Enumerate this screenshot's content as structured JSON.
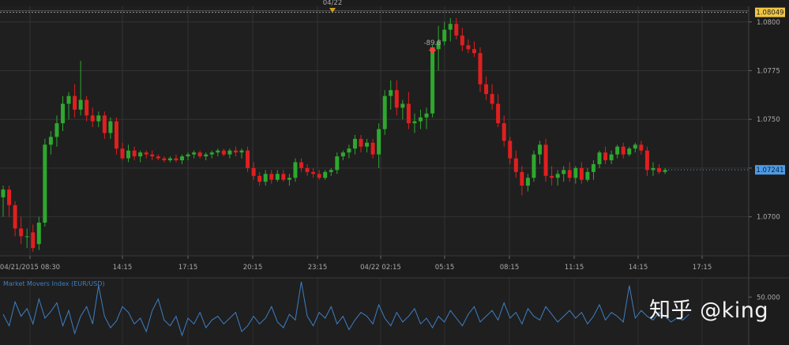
{
  "chart_data": [
    {
      "type": "candlestick",
      "title": "",
      "date_marker": "04/22",
      "x_tick_labels": [
        "04/21/2015 08:30",
        "14:15",
        "17:15",
        "20:15",
        "23:15",
        "04/22 02:15",
        "05:15",
        "08:15",
        "11:15",
        "14:15",
        "17:15"
      ],
      "y_ticks": [
        1.08,
        1.0775,
        1.075,
        1.0725,
        1.07
      ],
      "y_tick_labels": [
        "1.0800",
        "1.0775",
        "1.0750",
        "1.0725",
        "1.0700"
      ],
      "ylim": [
        1.068,
        1.0808
      ],
      "top_line": {
        "value": 1.08049,
        "label": "1.08049",
        "color": "#f2c744"
      },
      "last_price": {
        "value": 1.07241,
        "label": "1.07241",
        "color": "#4d9be6"
      },
      "annotation": {
        "text": "-89.8",
        "x_index": 72
      },
      "up_color": "#2ea82e",
      "down_color": "#e01f1f",
      "candles": [
        [
          1.071,
          1.0716,
          1.07,
          1.0714
        ],
        [
          1.0714,
          1.0716,
          1.07,
          1.0706
        ],
        [
          1.0706,
          1.0708,
          1.069,
          1.0694
        ],
        [
          1.0694,
          1.07,
          1.0686,
          1.069
        ],
        [
          1.069,
          1.0694,
          1.0684,
          1.069
        ],
        [
          1.0692,
          1.0696,
          1.0682,
          1.0684
        ],
        [
          1.0686,
          1.07,
          1.0683,
          1.0697
        ],
        [
          1.0697,
          1.074,
          1.0695,
          1.0737
        ],
        [
          1.0737,
          1.0744,
          1.0732,
          1.0741
        ],
        [
          1.0741,
          1.0752,
          1.0736,
          1.0748
        ],
        [
          1.0748,
          1.0762,
          1.0744,
          1.0758
        ],
        [
          1.0758,
          1.0764,
          1.075,
          1.0762
        ],
        [
          1.0762,
          1.0768,
          1.0751,
          1.0755
        ],
        [
          1.0755,
          1.078,
          1.0752,
          1.076
        ],
        [
          1.076,
          1.0762,
          1.0749,
          1.0752
        ],
        [
          1.0752,
          1.0756,
          1.0746,
          1.0749
        ],
        [
          1.0749,
          1.0754,
          1.0746,
          1.0752
        ],
        [
          1.0752,
          1.0754,
          1.074,
          1.0743
        ],
        [
          1.0743,
          1.0751,
          1.074,
          1.0749
        ],
        [
          1.0749,
          1.0751,
          1.0732,
          1.0735
        ],
        [
          1.0735,
          1.0738,
          1.0729,
          1.073
        ],
        [
          1.073,
          1.0737,
          1.0728,
          1.0734
        ],
        [
          1.0734,
          1.0736,
          1.0729,
          1.0731
        ],
        [
          1.0731,
          1.0734,
          1.0728,
          1.0733
        ],
        [
          1.0733,
          1.0734,
          1.073,
          1.0732
        ],
        [
          1.0732,
          1.0734,
          1.0729,
          1.0731
        ],
        [
          1.0731,
          1.0732,
          1.0729,
          1.073
        ],
        [
          1.073,
          1.0731,
          1.0728,
          1.0729
        ],
        [
          1.0729,
          1.0731,
          1.0728,
          1.073
        ],
        [
          1.073,
          1.0732,
          1.0728,
          1.0729
        ],
        [
          1.0729,
          1.0732,
          1.0727,
          1.0731
        ],
        [
          1.0731,
          1.0733,
          1.0729,
          1.0732
        ],
        [
          1.0732,
          1.0734,
          1.073,
          1.0733
        ],
        [
          1.0733,
          1.0734,
          1.073,
          1.0731
        ],
        [
          1.0731,
          1.0733,
          1.0729,
          1.0732
        ],
        [
          1.0732,
          1.0734,
          1.073,
          1.0733
        ],
        [
          1.0733,
          1.0735,
          1.0731,
          1.0734
        ],
        [
          1.0734,
          1.0735,
          1.0731,
          1.0732
        ],
        [
          1.0732,
          1.0735,
          1.073,
          1.0734
        ],
        [
          1.0734,
          1.0736,
          1.0731,
          1.0733
        ],
        [
          1.0733,
          1.0735,
          1.073,
          1.0734
        ],
        [
          1.0734,
          1.0736,
          1.0723,
          1.0725
        ],
        [
          1.0725,
          1.0728,
          1.0719,
          1.0721
        ],
        [
          1.0721,
          1.0723,
          1.0716,
          1.0718
        ],
        [
          1.0718,
          1.0724,
          1.0716,
          1.0722
        ],
        [
          1.0722,
          1.0724,
          1.0717,
          1.0719
        ],
        [
          1.0719,
          1.0724,
          1.0718,
          1.0722
        ],
        [
          1.0722,
          1.0724,
          1.0718,
          1.0719
        ],
        [
          1.0719,
          1.0722,
          1.0716,
          1.072
        ],
        [
          1.072,
          1.073,
          1.0718,
          1.0728
        ],
        [
          1.0728,
          1.073,
          1.0723,
          1.0725
        ],
        [
          1.0725,
          1.0727,
          1.0721,
          1.0723
        ],
        [
          1.0723,
          1.0725,
          1.072,
          1.0722
        ],
        [
          1.0722,
          1.0724,
          1.0719,
          1.072
        ],
        [
          1.072,
          1.0724,
          1.0719,
          1.0723
        ],
        [
          1.0723,
          1.0725,
          1.0721,
          1.0724
        ],
        [
          1.0724,
          1.0733,
          1.0722,
          1.0731
        ],
        [
          1.0731,
          1.0734,
          1.0729,
          1.0733
        ],
        [
          1.0733,
          1.0737,
          1.073,
          1.0735
        ],
        [
          1.0735,
          1.0742,
          1.0732,
          1.074
        ],
        [
          1.074,
          1.0742,
          1.0733,
          1.0736
        ],
        [
          1.0736,
          1.074,
          1.0733,
          1.0738
        ],
        [
          1.0738,
          1.074,
          1.073,
          1.0732
        ],
        [
          1.0732,
          1.0748,
          1.0725,
          1.0745
        ],
        [
          1.0745,
          1.0765,
          1.0742,
          1.0762
        ],
        [
          1.0762,
          1.077,
          1.0755,
          1.0765
        ],
        [
          1.0765,
          1.077,
          1.0752,
          1.0756
        ],
        [
          1.0756,
          1.076,
          1.075,
          1.0758
        ],
        [
          1.0758,
          1.0764,
          1.0745,
          1.0748
        ],
        [
          1.0748,
          1.0753,
          1.0743,
          1.0749
        ],
        [
          1.0749,
          1.0755,
          1.0745,
          1.0751
        ],
        [
          1.0751,
          1.0756,
          1.0745,
          1.0753
        ],
        [
          1.0753,
          1.0788,
          1.0751,
          1.0786
        ],
        [
          1.0786,
          1.0798,
          1.0775,
          1.079
        ],
        [
          1.079,
          1.08,
          1.0788,
          1.0796
        ],
        [
          1.0796,
          1.0802,
          1.079,
          1.0799
        ],
        [
          1.0799,
          1.0802,
          1.0791,
          1.0793
        ],
        [
          1.0793,
          1.0797,
          1.0785,
          1.0788
        ],
        [
          1.0788,
          1.0791,
          1.0784,
          1.0786
        ],
        [
          1.0786,
          1.079,
          1.0782,
          1.0784
        ],
        [
          1.0784,
          1.0787,
          1.0764,
          1.0768
        ],
        [
          1.0768,
          1.0772,
          1.076,
          1.0763
        ],
        [
          1.0763,
          1.0768,
          1.0755,
          1.0758
        ],
        [
          1.0758,
          1.0763,
          1.0746,
          1.0748
        ],
        [
          1.0748,
          1.0752,
          1.0736,
          1.0739
        ],
        [
          1.0739,
          1.0741,
          1.0727,
          1.073
        ],
        [
          1.073,
          1.0734,
          1.072,
          1.0723
        ],
        [
          1.0723,
          1.0726,
          1.0711,
          1.0716
        ],
        [
          1.0716,
          1.0722,
          1.0713,
          1.072
        ],
        [
          1.072,
          1.0734,
          1.0718,
          1.0732
        ],
        [
          1.0732,
          1.0739,
          1.0727,
          1.0737
        ],
        [
          1.0737,
          1.074,
          1.0718,
          1.0721
        ],
        [
          1.0721,
          1.0726,
          1.0716,
          1.072
        ],
        [
          1.072,
          1.0724,
          1.0716,
          1.0722
        ],
        [
          1.0722,
          1.0726,
          1.0718,
          1.0724
        ],
        [
          1.0724,
          1.0728,
          1.0718,
          1.072
        ],
        [
          1.072,
          1.0726,
          1.0717,
          1.0725
        ],
        [
          1.0725,
          1.0728,
          1.0717,
          1.0719
        ],
        [
          1.0719,
          1.0725,
          1.0718,
          1.0723
        ],
        [
          1.0723,
          1.0729,
          1.0719,
          1.0727
        ],
        [
          1.0727,
          1.0734,
          1.0725,
          1.0733
        ],
        [
          1.0733,
          1.0736,
          1.0727,
          1.0729
        ],
        [
          1.0729,
          1.0734,
          1.0727,
          1.0732
        ],
        [
          1.0732,
          1.0737,
          1.073,
          1.0736
        ],
        [
          1.0736,
          1.0738,
          1.073,
          1.0732
        ],
        [
          1.0732,
          1.0736,
          1.0731,
          1.0735
        ],
        [
          1.0735,
          1.0738,
          1.0733,
          1.0737
        ],
        [
          1.0737,
          1.0739,
          1.0732,
          1.0734
        ],
        [
          1.0734,
          1.0736,
          1.0721,
          1.0724
        ],
        [
          1.0724,
          1.0728,
          1.0721,
          1.0725
        ],
        [
          1.0725,
          1.0727,
          1.0722,
          1.0723
        ],
        [
          1.0723,
          1.0725,
          1.0722,
          1.0724
        ]
      ]
    },
    {
      "type": "line",
      "title": "Market Movers Index (EUR/USD)",
      "y_tick_labels": [
        "50.000"
      ],
      "ylim": [
        0,
        70
      ],
      "color": "#3d7fc4",
      "values": [
        32,
        20,
        45,
        30,
        38,
        22,
        48,
        28,
        35,
        44,
        20,
        36,
        12,
        30,
        40,
        22,
        62,
        30,
        18,
        25,
        40,
        34,
        22,
        28,
        14,
        36,
        48,
        26,
        20,
        30,
        10,
        28,
        22,
        34,
        18,
        26,
        30,
        22,
        28,
        34,
        14,
        20,
        30,
        22,
        28,
        40,
        24,
        18,
        32,
        26,
        66,
        30,
        20,
        34,
        28,
        40,
        22,
        30,
        16,
        26,
        34,
        30,
        22,
        42,
        28,
        20,
        34,
        24,
        30,
        38,
        22,
        28,
        18,
        30,
        24,
        36,
        28,
        20,
        32,
        40,
        24,
        30,
        36,
        26,
        44,
        28,
        34,
        22,
        38,
        30,
        26,
        40,
        32,
        24,
        30,
        36,
        28,
        34,
        22,
        30,
        42,
        26,
        34,
        30,
        24,
        62,
        28,
        36,
        30,
        26,
        34,
        30,
        24,
        28,
        26,
        32
      ]
    }
  ],
  "watermark": "知乎 @king"
}
